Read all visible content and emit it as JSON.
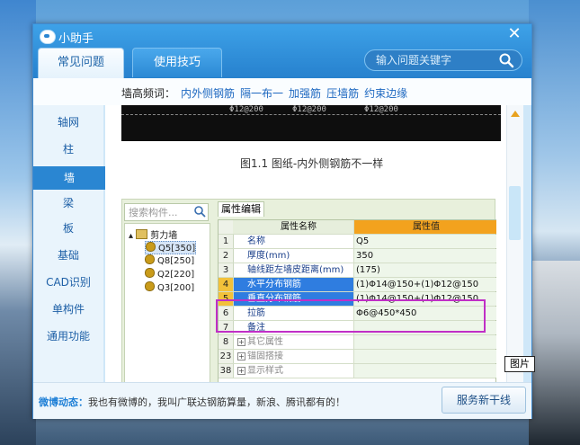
{
  "window": {
    "title": "小助手",
    "close_symbol": "✕"
  },
  "tabs": [
    {
      "label": "常见问题",
      "active": true
    },
    {
      "label": "使用技巧",
      "active": false
    }
  ],
  "search": {
    "placeholder": "输入问题关键字"
  },
  "hot_words": {
    "label": "墙高频词：",
    "items": [
      "内外侧钢筋",
      "隔一布一",
      "加强筋",
      "压墙筋",
      "约束边缘"
    ]
  },
  "sidebar": {
    "items": [
      {
        "label": "轴网"
      },
      {
        "label": "柱"
      },
      {
        "label": "墙",
        "active": true
      },
      {
        "label": "梁"
      },
      {
        "label": "板"
      },
      {
        "label": "基础"
      },
      {
        "label": "CAD识别"
      },
      {
        "label": "单构件"
      },
      {
        "label": "通用功能"
      }
    ]
  },
  "figure1": {
    "labels": [
      "Φ12@200",
      "Φ12@200",
      "Φ12@200"
    ],
    "caption": "图1.1 图纸-内外侧钢筋不一样"
  },
  "figure2": {
    "tree_search_placeholder": "搜索构件...",
    "tree": {
      "root": "剪力墙",
      "children": [
        "Q5[350]",
        "Q8[250]",
        "Q2[220]",
        "Q3[200]"
      ],
      "selected_index": 0
    },
    "prop_tab": "属性编辑",
    "headers": {
      "name": "属性名称",
      "value": "属性值"
    },
    "rows": [
      {
        "num": "1",
        "name": "名称",
        "value": "Q5"
      },
      {
        "num": "2",
        "name": "厚度(mm)",
        "value": "350"
      },
      {
        "num": "3",
        "name": "轴线距左墙皮距离(mm)",
        "value": "(175)"
      },
      {
        "num": "4",
        "name": "水平分布钢筋",
        "value": "(1)Φ14@150+(1)Φ12@150",
        "highlight": true
      },
      {
        "num": "5",
        "name": "垂直分布钢筋",
        "value": "(1)Φ14@150+(1)Φ12@150",
        "highlight": true
      },
      {
        "num": "6",
        "name": "拉筋",
        "value": "Φ6@450*450"
      },
      {
        "num": "7",
        "name": "备注",
        "value": ""
      },
      {
        "num": "8",
        "name": "其它属性",
        "value": "",
        "group": true
      },
      {
        "num": "23",
        "name": "锚固搭接",
        "value": "",
        "group": true
      },
      {
        "num": "38",
        "name": "显示样式",
        "value": "",
        "group": true
      }
    ]
  },
  "badge": "图片",
  "footer": {
    "weibo_label": "微博动态：",
    "weibo_text": "我也有微博的，我叫广联达钢筋算量，新浪、腾讯都有的！",
    "service_button": "服务新干线"
  }
}
